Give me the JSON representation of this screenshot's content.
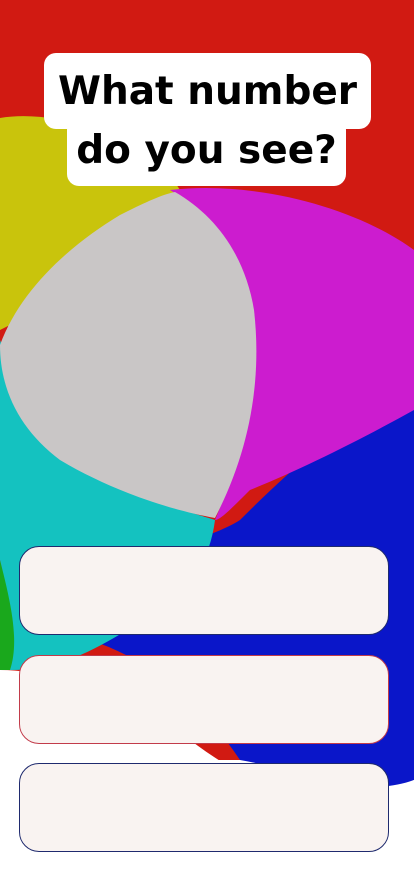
{
  "question": {
    "line1": "What number",
    "line2": "do you see?"
  },
  "colors": {
    "red": "#d11a12",
    "yellow": "#c9c40c",
    "magenta": "#cc1ccf",
    "cyan": "#14c2c0",
    "blue": "#0a16c9",
    "green": "#1aa81c",
    "white_center": "#c9c6c6",
    "answer_fill": "#f9f3f1",
    "answer_border": "#1f2a6e"
  },
  "answers": [
    {
      "label": ""
    },
    {
      "label": ""
    },
    {
      "label": ""
    }
  ]
}
